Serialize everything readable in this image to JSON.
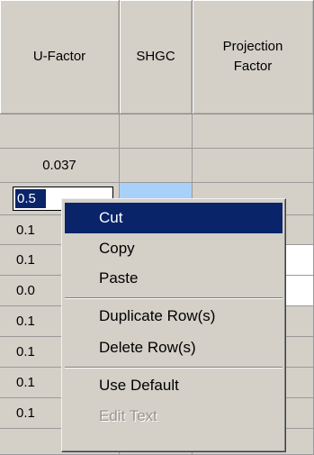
{
  "columns": [
    "U-Factor",
    "SHGC",
    "Projection\nFactor"
  ],
  "rows": [
    {
      "u": ""
    },
    {
      "u": "0.037"
    },
    {
      "u": "0.5"
    },
    {
      "u": "0.1"
    },
    {
      "u": "0.1"
    },
    {
      "u": "0.0"
    },
    {
      "u": "0.1"
    },
    {
      "u": "0.1"
    },
    {
      "u": "0.1"
    },
    {
      "u": "0.1"
    }
  ],
  "edit_cell_value": "0.5",
  "context_menu": {
    "items": [
      "Cut",
      "Copy",
      "Paste",
      "Duplicate Row(s)",
      "Delete Row(s)",
      "Use Default",
      "Edit Text"
    ],
    "highlighted": "Cut",
    "disabled": [
      "Edit Text"
    ]
  },
  "colors": {
    "highlight": "#0a246a",
    "menu_bg": "#d4d0c8",
    "selected_cell": "#a8d0f8"
  }
}
